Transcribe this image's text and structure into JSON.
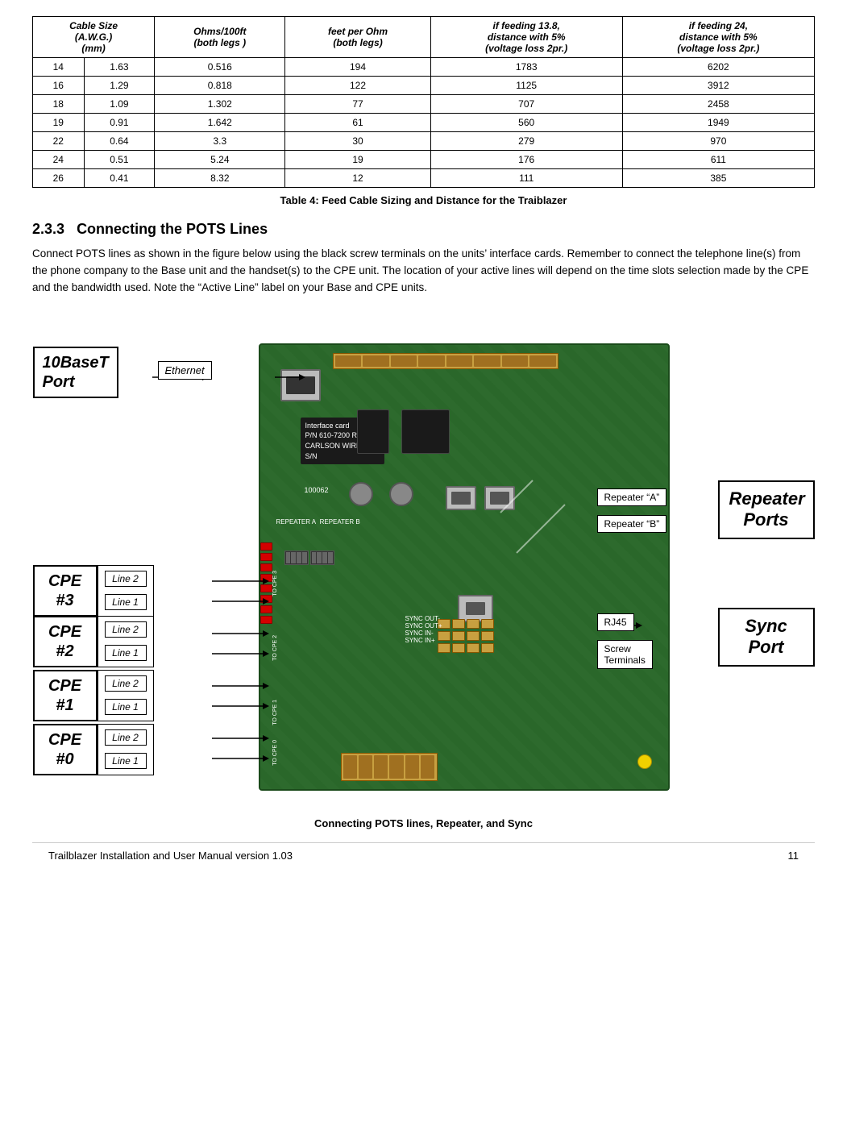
{
  "table": {
    "caption": "Table 4: Feed Cable Sizing and Distance for the Traiblazer",
    "headers": [
      "Cable Size\n(A.W.G.)\n(mm)",
      "Ohms/100ft\n(both legs )",
      "feet per Ohm\n(both legs)",
      "if feeding 13.8,\ndistance with 5%\n(voltage loss 2pr.)",
      "if feeding 24,\ndistance with 5%\n(voltage loss 2pr.)"
    ],
    "sub_headers": [
      "",
      "",
      "",
      "",
      ""
    ],
    "rows": [
      [
        "14",
        "1.63",
        "0.516",
        "194",
        "1783",
        "6202"
      ],
      [
        "16",
        "1.29",
        "0.818",
        "122",
        "1125",
        "3912"
      ],
      [
        "18",
        "1.09",
        "1.302",
        "77",
        "707",
        "2458"
      ],
      [
        "19",
        "0.91",
        "1.642",
        "61",
        "560",
        "1949"
      ],
      [
        "22",
        "0.64",
        "3.3",
        "30",
        "279",
        "970"
      ],
      [
        "24",
        "0.51",
        "5.24",
        "19",
        "176",
        "611"
      ],
      [
        "26",
        "0.41",
        "8.32",
        "12",
        "111",
        "385"
      ]
    ]
  },
  "section": {
    "number": "2.3.3",
    "title": "Connecting the POTS Lines",
    "body": "Connect POTS lines as shown in the figure below using the black screw terminals on the units’ interface cards.  Remember to connect the telephone line(s) from the phone company to the Base unit and the handset(s) to the CPE unit.  The location of your active lines will depend on the time slots selection made by the CPE and the bandwidth used.  Note the “Active Line” label on your Base and CPE units."
  },
  "diagram": {
    "label_10base_port": "10BaseT\nPort",
    "label_ethernet": "Ethernet",
    "label_repeater_ports": "Repeater\nPorts",
    "label_repeater_a": "Repeater “A”",
    "label_repeater_b": "Repeater “B”",
    "label_sync_port": "Sync\nPort",
    "label_rj45": "RJ45",
    "label_screw_terminals": "Screw\nTerminals",
    "cpe_groups": [
      {
        "label": "CPE\n#3",
        "lines": [
          "Line 2",
          "Line 1"
        ]
      },
      {
        "label": "CPE\n#2",
        "lines": [
          "Line 2",
          "Line 1"
        ]
      },
      {
        "label": "CPE\n#1",
        "lines": [
          "Line 2",
          "Line 1"
        ]
      },
      {
        "label": "CPE\n#0",
        "lines": [
          "Line 2",
          "Line 1"
        ]
      }
    ],
    "pcb_text": "Interface card\nP/N 610-7200 Rev\nCARLSON WIRELESS\nS/N",
    "pcb_sn": "100062"
  },
  "figure_caption": "Connecting POTS lines, Repeater, and Sync",
  "footer": {
    "left": "Trailblazer Installation and User Manual version 1.03",
    "right": "11"
  }
}
